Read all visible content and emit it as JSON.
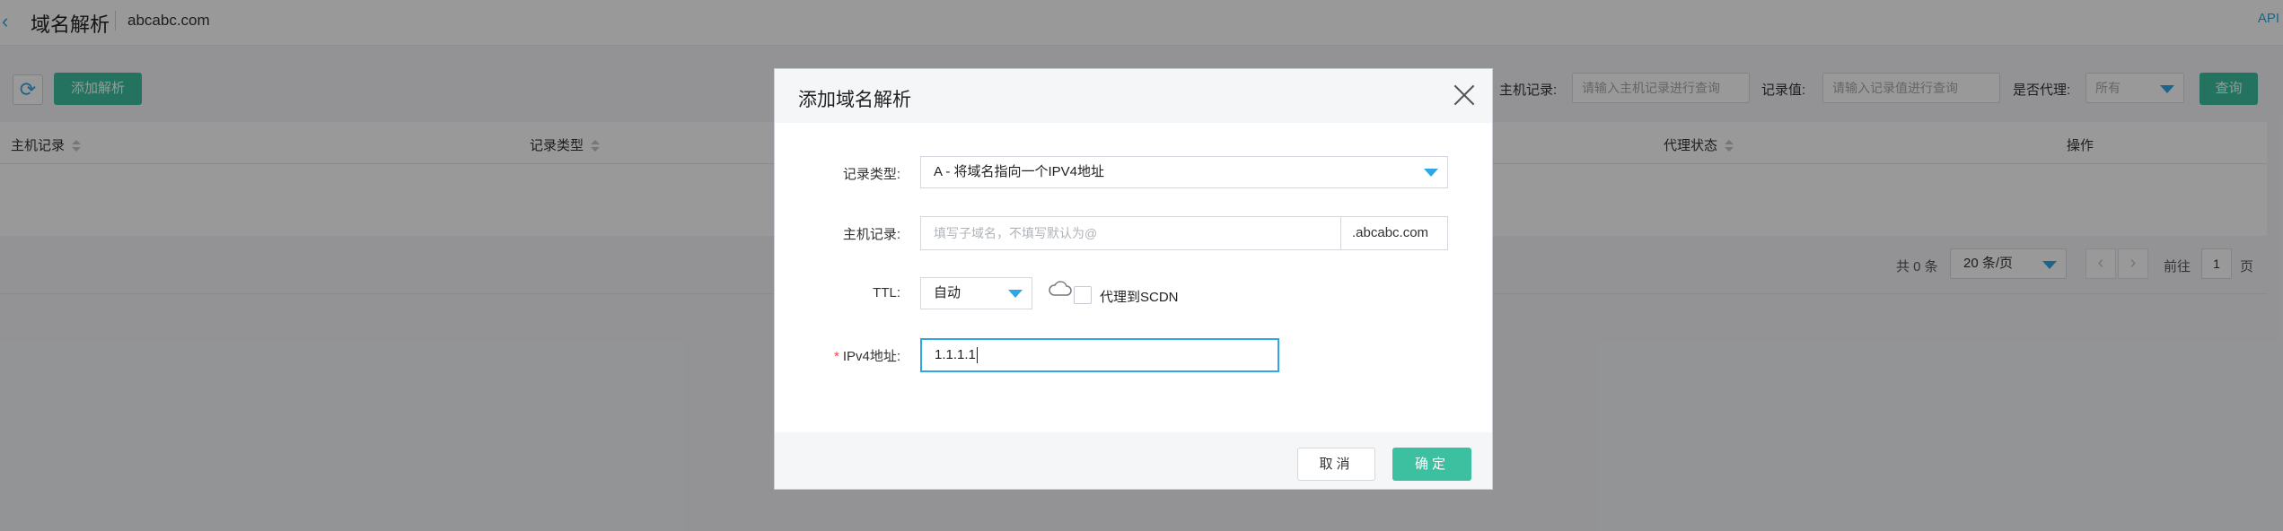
{
  "header": {
    "title": "域名解析",
    "domain": "abcabc.com",
    "api_link": "API"
  },
  "toolbar": {
    "add_label": "添加解析",
    "host_filter_label": "主机记录:",
    "host_filter_placeholder": "请输入主机记录进行查询",
    "value_filter_label": "记录值:",
    "value_filter_placeholder": "请输入记录值进行查询",
    "proxy_filter_label": "是否代理:",
    "proxy_filter_value": "所有",
    "query_label": "查询"
  },
  "table": {
    "columns": [
      "主机记录",
      "记录类型",
      "代理状态",
      "操作"
    ],
    "footer": {
      "total": "共 0 条",
      "page_size": "20 条/页",
      "goto_label": "前往",
      "page": "1",
      "page_unit": "页"
    }
  },
  "modal": {
    "title": "添加域名解析",
    "type_label": "记录类型:",
    "type_value": "A  -  将域名指向一个IPV4地址",
    "host_label": "主机记录:",
    "host_placeholder": "填写子域名，不填写默认为@",
    "host_suffix": ".abcabc.com",
    "ttl_label": "TTL:",
    "ttl_value": "自动",
    "proxy_label": "代理到SCDN",
    "ipv4_label": "IPv4地址:",
    "ipv4_value": "1.1.1.1",
    "required_mark": "*",
    "cancel_label": "取消",
    "confirm_label": "确定"
  },
  "colors": {
    "accent": "#2fa7e6",
    "primary_button": "#3cc0a0",
    "required": "#f04848"
  }
}
